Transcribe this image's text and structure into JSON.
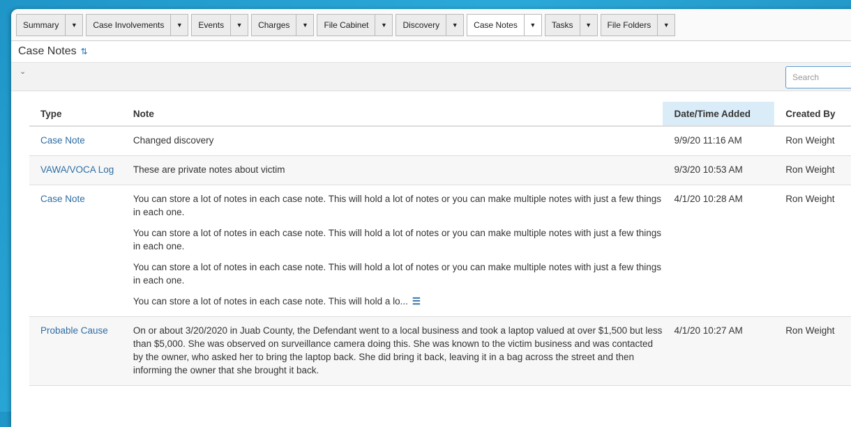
{
  "tabs": [
    {
      "label": "Summary",
      "active": false
    },
    {
      "label": "Case Involvements",
      "active": false
    },
    {
      "label": "Events",
      "active": false
    },
    {
      "label": "Charges",
      "active": false
    },
    {
      "label": "File Cabinet",
      "active": false
    },
    {
      "label": "Discovery",
      "active": false
    },
    {
      "label": "Case Notes",
      "active": true
    },
    {
      "label": "Tasks",
      "active": false
    },
    {
      "label": "File Folders",
      "active": false
    }
  ],
  "page_title": "Case Notes",
  "search": {
    "placeholder": "Search",
    "value": ""
  },
  "columns": {
    "type": "Type",
    "note": "Note",
    "date": "Date/Time Added",
    "created_by": "Created By"
  },
  "rows": [
    {
      "type": "Case Note",
      "notes": [
        "Changed discovery"
      ],
      "date": "9/9/20 11:16 AM",
      "created_by": "Ron Weight"
    },
    {
      "type": "VAWA/VOCA Log",
      "notes": [
        "These are private notes about victim"
      ],
      "date": "9/3/20 10:53 AM",
      "created_by": "Ron Weight"
    },
    {
      "type": "Case Note",
      "notes": [
        "You can store a lot of notes in each case note. This will hold a lot of notes or you can make multiple notes with just a few things in each one.",
        "You can store a lot of notes in each case note. This will hold a lot of notes or you can make multiple notes with just a few things in each one.",
        "You can store a lot of notes in each case note. This will hold a lot of notes or you can make multiple notes with just a few things in each one.",
        "You can store a lot of notes in each case note. This will hold a lo..."
      ],
      "date": "4/1/20 10:28 AM",
      "created_by": "Ron Weight",
      "truncated": true
    },
    {
      "type": "Probable Cause",
      "notes": [
        "On or about 3/20/2020 in Juab County, the Defendant went to a local business and took a laptop valued at over $1,500 but less than $5,000. She was observed on surveillance camera doing this. She was known to the victim business and was contacted by the owner, who asked her to bring the laptop back. She did bring it back, leaving it in a bag across the street and then informing the owner that she brought it back."
      ],
      "date": "4/1/20 10:27 AM",
      "created_by": "Ron Weight"
    }
  ],
  "icons": {
    "refresh": "refresh-icon",
    "collapse": "chevron-down-icon",
    "more": "expand-text-icon",
    "tab_caret": "caret-down-icon"
  }
}
